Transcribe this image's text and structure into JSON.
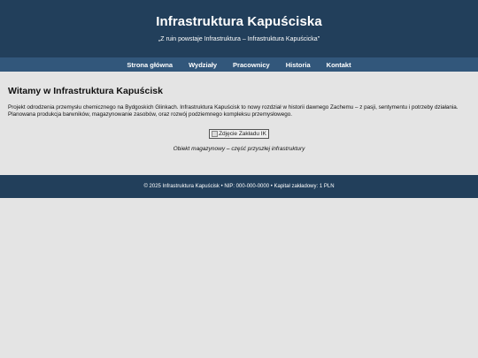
{
  "header": {
    "title": "Infrastruktura Kapuściska",
    "tagline": "„Z ruin powstaje Infrastruktura – Infrastruktura Kapuścicka”"
  },
  "nav": {
    "items": [
      "Strona główna",
      "Wydziały",
      "Pracownicy",
      "Historia",
      "Kontakt"
    ]
  },
  "main": {
    "heading": "Witamy w Infrastruktura Kapuścisk",
    "intro": "Projekt odrodzenia przemysłu chemicznego na Bydgoskich Glinkach. Infrastruktura Kapuścisk to nowy rozdział w historii dawnego Zachemu – z pasji, sentymentu i potrzeby działania. Planowana produkcja barwników, magazynowanie zasobów, oraz rozwój podziemnego kompleksu przemysłowego.",
    "image_alt": "Zdjęcie Zakładu IK",
    "caption": "Obiekt magazynowy – część przyszłej infrastruktury"
  },
  "footer": {
    "text": "© 2025 Infrastruktura Kapuścisk • NIP: 000-000-0000 • Kapitał zakładowy: 1 PLN"
  },
  "colors": {
    "header_bg": "#223f5b",
    "nav_bg": "#32577b",
    "page_bg": "#e4e4e4"
  }
}
